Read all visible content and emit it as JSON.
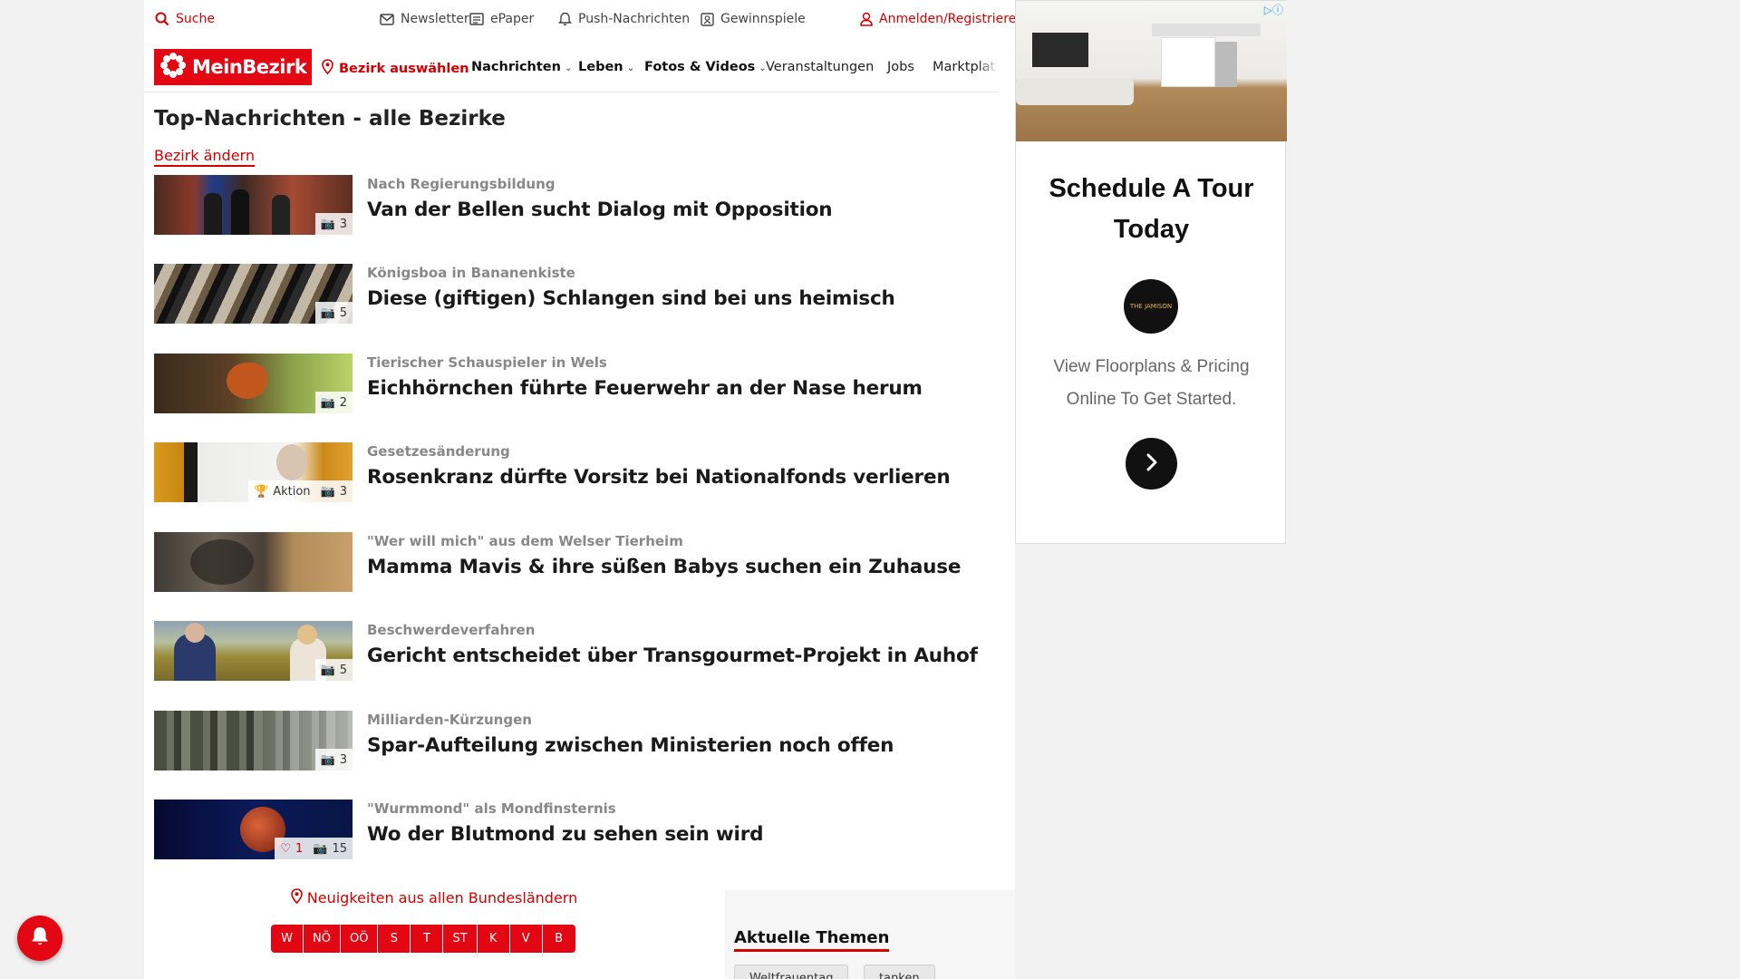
{
  "topbar": {
    "search": "Suche",
    "newsletter": "Newsletter",
    "epaper": "ePaper",
    "push": "Push-Nachrichten",
    "gewinnspiele": "Gewinnspiele",
    "login": "Anmelden/Registrieren"
  },
  "nav": {
    "logo": "MeinBezirk",
    "bezirk": "Bezirk auswählen",
    "items": [
      "Nachrichten",
      "Leben",
      "Fotos & Videos",
      "Veranstaltungen",
      "Jobs",
      "Marktplatz"
    ]
  },
  "main": {
    "title": "Top-Nachrichten - alle Bezirke",
    "change_link": "Bezirk ändern",
    "articles": [
      {
        "kicker": "Nach Regierungsbildung",
        "headline": "Van der Bellen sucht Dialog mit Opposition",
        "photos": "3"
      },
      {
        "kicker": "Königsboa in Bananenkiste",
        "headline": "Diese (giftigen) Schlangen sind bei uns heimisch",
        "photos": "5"
      },
      {
        "kicker": "Tierischer Schauspieler in Wels",
        "headline": "Eichhörnchen führte Feuerwehr an der Nase herum",
        "photos": "2"
      },
      {
        "kicker": "Gesetzesänderung",
        "headline": "Rosenkranz dürfte Vorsitz bei Nationalfonds verlieren",
        "photos": "3",
        "aktion": "Aktion"
      },
      {
        "kicker": "\"Wer will mich\" aus dem Welser Tierheim",
        "headline": "Mamma Mavis & ihre süßen Babys suchen ein Zuhause"
      },
      {
        "kicker": "Beschwerdeverfahren",
        "headline": "Gericht entscheidet über Transgourmet-Projekt in Auhof",
        "photos": "5"
      },
      {
        "kicker": "Milliarden-Kürzungen",
        "headline": "Spar-Aufteilung zwischen Ministerien noch offen",
        "photos": "3"
      },
      {
        "kicker": "\"Wurmmond\" als Mondfinsternis",
        "headline": "Wo der Blutmond zu sehen sein wird",
        "photos": "15",
        "likes": "1"
      }
    ],
    "bundeslaender_label": "Neuigkeiten aus allen Bundesländern",
    "states": [
      "W",
      "NÖ",
      "OÖ",
      "S",
      "T",
      "ST",
      "K",
      "V",
      "B"
    ]
  },
  "themes": {
    "title": "Aktuelle Themen",
    "chips": [
      "Weltfrauentag",
      "tanken"
    ]
  },
  "ad": {
    "title_line1": "Schedule A Tour",
    "title_line2": "Today",
    "logo_text": "THE JAMISON",
    "text_line1": "View Floorplans & Pricing",
    "text_line2": "Online To Get Started."
  },
  "colors": {
    "brand": "#e30613",
    "link": "#d40000"
  }
}
